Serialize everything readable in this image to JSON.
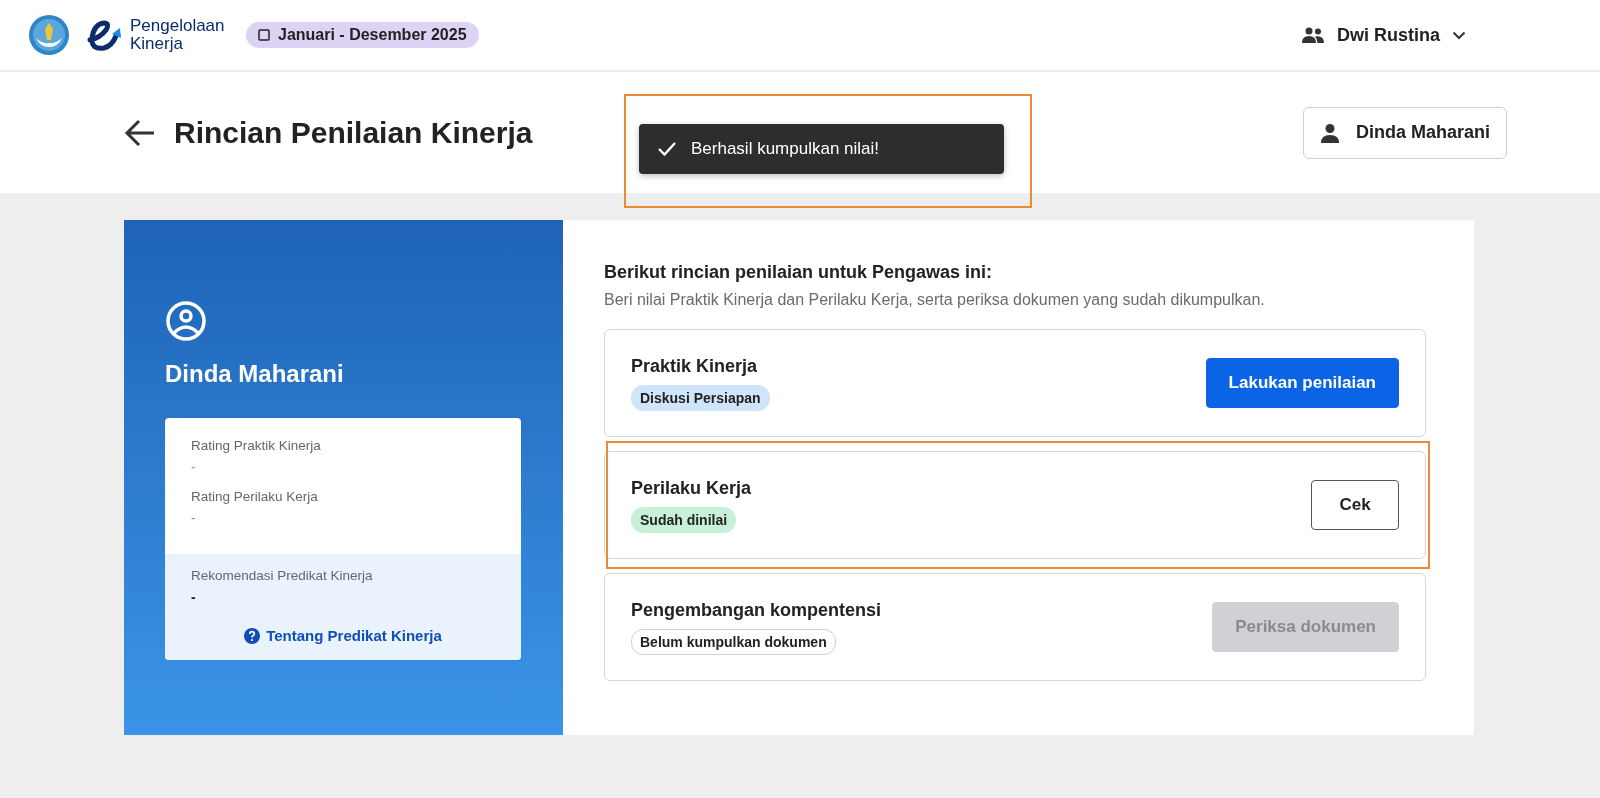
{
  "header": {
    "brand": "Pengelolaan Kinerja",
    "period": "Januari - Desember 2025",
    "user": "Dwi Rustina"
  },
  "title_bar": {
    "title": "Rincian Penilaian Kinerja",
    "person_button": "Dinda Maharani"
  },
  "toast": {
    "message": "Berhasil kumpulkan nilai!",
    "highlighted": true
  },
  "profile": {
    "name": "Dinda Maharani",
    "ratings": [
      {
        "label": "Rating Praktik Kinerja",
        "value": "-"
      },
      {
        "label": "Rating Perilaku Kerja",
        "value": "-"
      }
    ],
    "recommendation": {
      "label": "Rekomendasi Predikat Kinerja",
      "value": "-"
    },
    "help_link": "Tentang Predikat Kinerja"
  },
  "details": {
    "heading": "Berikut rincian penilaian untuk Pengawas ini:",
    "subheading": "Beri nilai Praktik Kinerja dan Perilaku Kerja, serta periksa dokumen yang sudah dikumpulkan.",
    "sections": [
      {
        "title": "Praktik Kinerja",
        "badge": {
          "label": "Diskusi Persiapan",
          "kind": "info"
        },
        "button": {
          "label": "Lakukan penilaian",
          "kind": "primary",
          "disabled": false
        },
        "highlighted": false
      },
      {
        "title": "Perilaku Kerja",
        "badge": {
          "label": "Sudah dinilai",
          "kind": "success"
        },
        "button": {
          "label": "Cek",
          "kind": "outline",
          "disabled": false
        },
        "highlighted": true
      },
      {
        "title": "Pengembangan kompentensi",
        "badge": {
          "label": "Belum kumpulkan dokumen",
          "kind": "neutral"
        },
        "button": {
          "label": "Periksa dokumen",
          "kind": "primary",
          "disabled": true
        },
        "highlighted": false
      }
    ]
  }
}
